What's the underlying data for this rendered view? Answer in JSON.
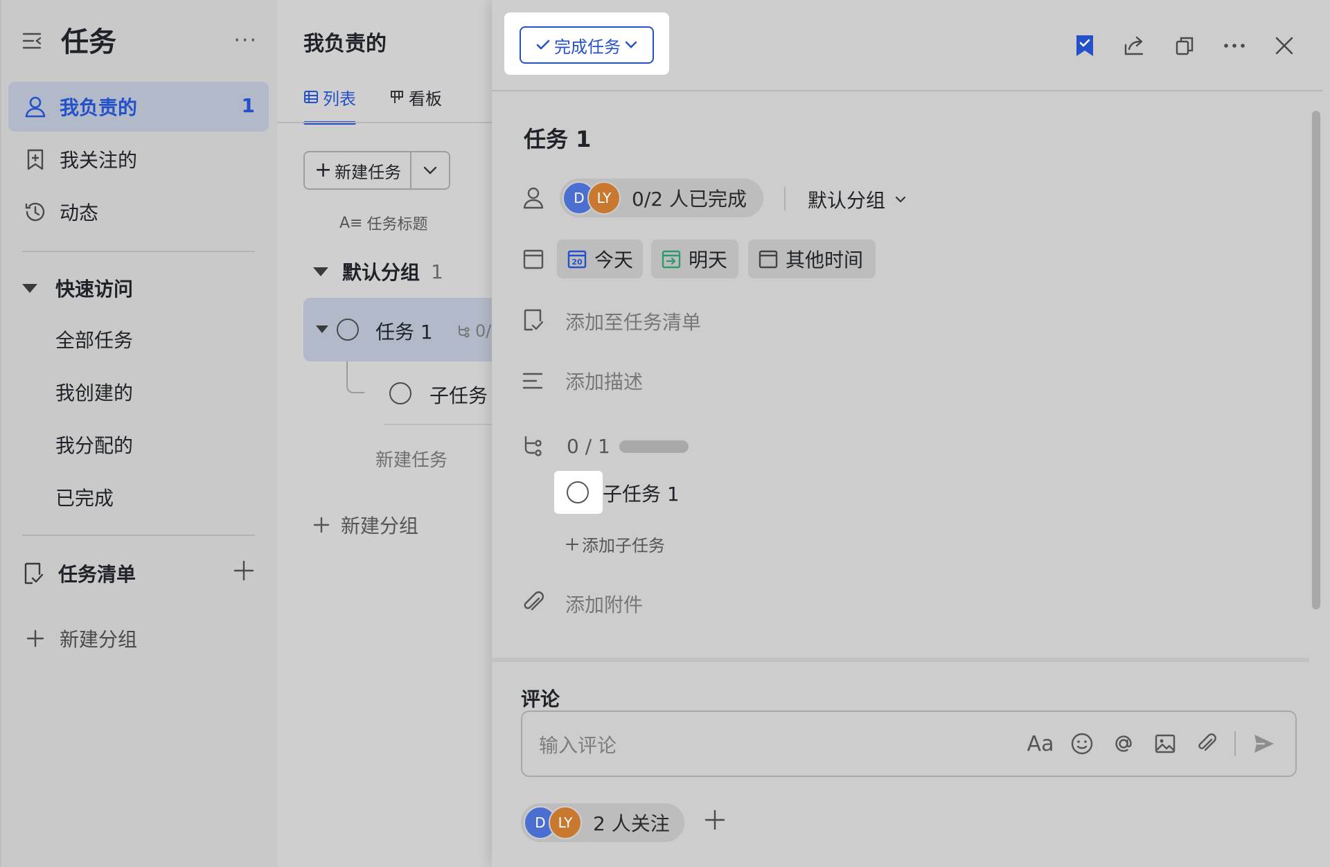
{
  "sidebar": {
    "title": "任务",
    "more": "···",
    "nav": [
      {
        "label": "我负责的",
        "count": "1"
      },
      {
        "label": "我关注的"
      },
      {
        "label": "动态"
      }
    ],
    "quick_access": {
      "title": "快速访问",
      "items": [
        "全部任务",
        "我创建的",
        "我分配的",
        "已完成"
      ]
    },
    "task_lists": {
      "title": "任务清单"
    },
    "new_group": "新建分组"
  },
  "list_panel": {
    "title": "我负责的",
    "tabs": [
      {
        "label": "列表",
        "active": true
      },
      {
        "label": "看板",
        "active": false
      }
    ],
    "new_task_button": "新建任务",
    "column_header": "任务标题",
    "group": {
      "name": "默认分组",
      "count": "1"
    },
    "task": {
      "name": "任务 1",
      "subtask_progress": "0/"
    },
    "subtask": {
      "name": "子任务"
    },
    "new_task": "新建任务",
    "new_group": "新建分组"
  },
  "detail": {
    "complete_button": "完成任务",
    "title": "任务 1",
    "assignees": {
      "avatars": [
        "D",
        "LY"
      ],
      "status": "0/2 人已完成"
    },
    "group_select": "默认分组",
    "dates": [
      {
        "label": "今天",
        "icon": "calendar-today-icon",
        "day": "20"
      },
      {
        "label": "明天",
        "icon": "calendar-tomorrow-icon"
      },
      {
        "label": "其他时间",
        "icon": "calendar-other-icon"
      }
    ],
    "add_to_list": "添加至任务清单",
    "add_description": "添加描述",
    "subtasks": {
      "progress": "0 / 1",
      "progress_fraction": 0,
      "items": [
        "子任务 1"
      ],
      "add": "添加子任务"
    },
    "add_attachment": "添加附件",
    "comments": {
      "label": "评论",
      "placeholder": "输入评论"
    },
    "followers": {
      "avatars": [
        "D",
        "LY"
      ],
      "text": "2 人关注"
    }
  },
  "colors": {
    "accent": "#2450c9",
    "avatar_d": "#4a6fd1",
    "avatar_ly": "#c9782f",
    "overlay_bg": "#cfcfcf"
  }
}
